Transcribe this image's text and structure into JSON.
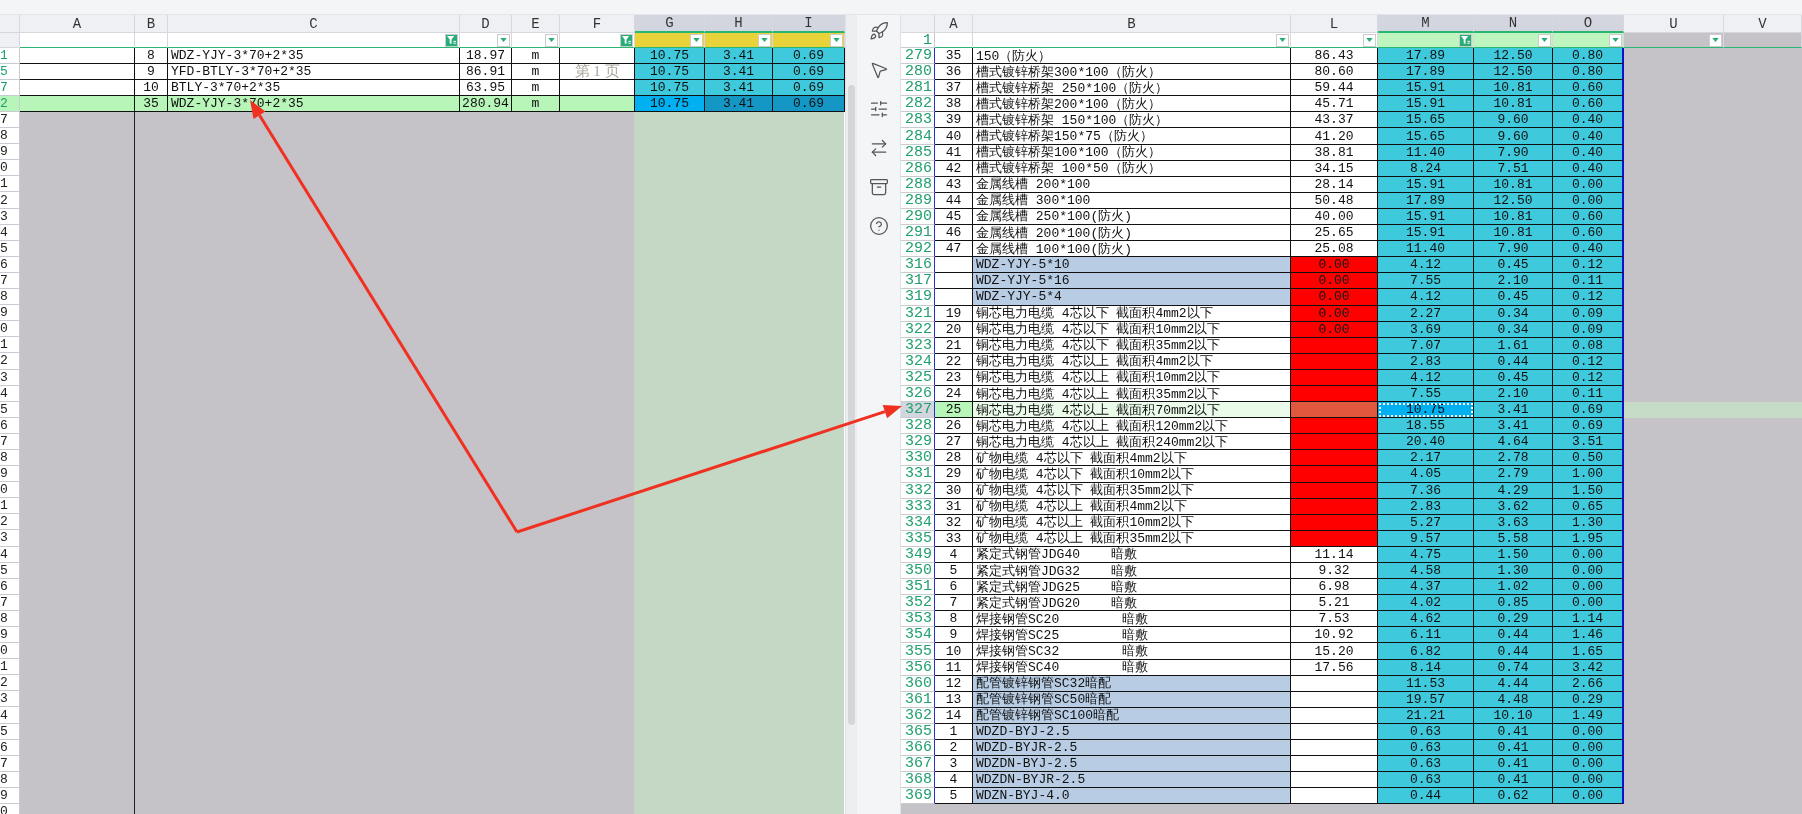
{
  "left_sheet": {
    "columns": [
      {
        "label": "A",
        "filter_button": false,
        "selected": false,
        "color": "#ffffff"
      },
      {
        "label": "B",
        "filter_button": false,
        "selected": false,
        "color": "#ffffff"
      },
      {
        "label": "C",
        "filter_button": true,
        "filter_applied": true,
        "selected": false,
        "color": "#ffffff"
      },
      {
        "label": "D",
        "filter_button": true,
        "filter_applied": false,
        "selected": false,
        "color": "#ffffff"
      },
      {
        "label": "E",
        "filter_button": true,
        "filter_applied": false,
        "selected": false,
        "color": "#ffffff"
      },
      {
        "label": "F",
        "filter_button": true,
        "filter_applied": true,
        "selected": false,
        "color": "#ffffff"
      },
      {
        "label": "G",
        "filter_button": true,
        "filter_applied": false,
        "selected": true,
        "color": "#e8d43a"
      },
      {
        "label": "H",
        "filter_button": true,
        "filter_applied": false,
        "selected": true,
        "color": "#e8d43a"
      },
      {
        "label": "I",
        "filter_button": true,
        "filter_applied": false,
        "selected": true,
        "color": "#e8d43a"
      }
    ],
    "rows": [
      {
        "header": "1",
        "selected": false,
        "cells": [
          "",
          "8",
          "WDZ-YJY-3*70+2*35",
          "18.97",
          "m",
          "",
          "10.75",
          "3.41",
          "0.69"
        ]
      },
      {
        "header": "5",
        "selected": false,
        "cells": [
          "",
          "9",
          "YFD-BTLY-3*70+2*35",
          "86.91",
          "m",
          "",
          "10.75",
          "3.41",
          "0.69"
        ]
      },
      {
        "header": "7",
        "selected": false,
        "cells": [
          "",
          "10",
          "BTLY-3*70+2*35",
          "63.95",
          "m",
          "",
          "10.75",
          "3.41",
          "0.69"
        ]
      },
      {
        "header": "2",
        "selected": true,
        "cells": [
          "",
          "35",
          "WDZ-YJY-3*70+2*35",
          "280.94",
          "m",
          "",
          "10.75",
          "3.41",
          "0.69"
        ]
      }
    ],
    "page_label": "第 1 页",
    "empty_row_headers": [
      "7",
      "8",
      "9",
      "0",
      "1",
      "2",
      "3",
      "4",
      "5",
      "6",
      "7",
      "8",
      "9",
      "0",
      "1",
      "2",
      "3",
      "4",
      "5",
      "6",
      "7",
      "8",
      "9",
      "0",
      "1",
      "2",
      "3",
      "4",
      "5",
      "6",
      "7",
      "8",
      "9",
      "0",
      "1",
      "2",
      "3",
      "4",
      "5",
      "6",
      "7",
      "8",
      "9",
      "0"
    ]
  },
  "right_sheet": {
    "filter_row_label": "1",
    "columns": [
      {
        "label": "A",
        "filter_button": false,
        "selected": false,
        "color": "#ffffff"
      },
      {
        "label": "B",
        "filter_button": true,
        "filter_applied": false,
        "selected": false,
        "color": "#ffffff"
      },
      {
        "label": "L",
        "filter_button": true,
        "filter_applied": false,
        "selected": false,
        "color": "#ffffff"
      },
      {
        "label": "M",
        "filter_button": true,
        "filter_applied": true,
        "selected": true,
        "color": "#bff5bf"
      },
      {
        "label": "N",
        "filter_button": true,
        "filter_applied": false,
        "selected": true,
        "color": "#bff5bf"
      },
      {
        "label": "O",
        "filter_button": true,
        "filter_applied": false,
        "selected": true,
        "color": "#bff5bf"
      },
      {
        "label": "U",
        "filter_button": true,
        "filter_applied": false,
        "selected": false,
        "color": "#c5c3c8"
      },
      {
        "label": "V",
        "filter_button": false,
        "selected": false,
        "color": "#c5c3c8"
      }
    ],
    "rows": [
      {
        "header": "279",
        "a": "35",
        "b": "150（防火）",
        "l": "86.43",
        "m": "17.89",
        "n": "12.50",
        "o": "0.80",
        "b_shaded": false,
        "l_alert": false,
        "selected": false
      },
      {
        "header": "280",
        "a": "36",
        "b": "槽式镀锌桥架300*100（防火）",
        "l": "80.60",
        "m": "17.89",
        "n": "12.50",
        "o": "0.80",
        "b_shaded": false,
        "l_alert": false,
        "selected": false
      },
      {
        "header": "281",
        "a": "37",
        "b": "槽式镀锌桥架 250*100（防火）",
        "l": "59.44",
        "m": "15.91",
        "n": "10.81",
        "o": "0.60",
        "b_shaded": false,
        "l_alert": false,
        "selected": false
      },
      {
        "header": "282",
        "a": "38",
        "b": "槽式镀锌桥架200*100（防火）",
        "l": "45.71",
        "m": "15.91",
        "n": "10.81",
        "o": "0.60",
        "b_shaded": false,
        "l_alert": false,
        "selected": false
      },
      {
        "header": "283",
        "a": "39",
        "b": "槽式镀锌桥架 150*100（防火）",
        "l": "43.37",
        "m": "15.65",
        "n": "9.60",
        "o": "0.40",
        "b_shaded": false,
        "l_alert": false,
        "selected": false
      },
      {
        "header": "284",
        "a": "40",
        "b": "槽式镀锌桥架150*75（防火）",
        "l": "41.20",
        "m": "15.65",
        "n": "9.60",
        "o": "0.40",
        "b_shaded": false,
        "l_alert": false,
        "selected": false
      },
      {
        "header": "285",
        "a": "41",
        "b": "槽式镀锌桥架100*100（防火）",
        "l": "38.81",
        "m": "11.40",
        "n": "7.90",
        "o": "0.40",
        "b_shaded": false,
        "l_alert": false,
        "selected": false
      },
      {
        "header": "286",
        "a": "42",
        "b": "槽式镀锌桥架 100*50（防火）",
        "l": "34.15",
        "m": "8.24",
        "n": "7.51",
        "o": "0.40",
        "b_shaded": false,
        "l_alert": false,
        "selected": false
      },
      {
        "header": "288",
        "a": "43",
        "b": "金属线槽 200*100",
        "l": "28.14",
        "m": "15.91",
        "n": "10.81",
        "o": "0.00",
        "b_shaded": false,
        "l_alert": false,
        "selected": false
      },
      {
        "header": "289",
        "a": "44",
        "b": "金属线槽 300*100",
        "l": "50.48",
        "m": "17.89",
        "n": "12.50",
        "o": "0.00",
        "b_shaded": false,
        "l_alert": false,
        "selected": false
      },
      {
        "header": "290",
        "a": "45",
        "b": "金属线槽 250*100(防火)",
        "l": "40.00",
        "m": "15.91",
        "n": "10.81",
        "o": "0.60",
        "b_shaded": false,
        "l_alert": false,
        "selected": false
      },
      {
        "header": "291",
        "a": "46",
        "b": "金属线槽 200*100(防火)",
        "l": "25.65",
        "m": "15.91",
        "n": "10.81",
        "o": "0.60",
        "b_shaded": false,
        "l_alert": false,
        "selected": false
      },
      {
        "header": "292",
        "a": "47",
        "b": "金属线槽 100*100(防火)",
        "l": "25.08",
        "m": "11.40",
        "n": "7.90",
        "o": "0.40",
        "b_shaded": false,
        "l_alert": false,
        "selected": false
      },
      {
        "header": "316",
        "a": "",
        "b": "WDZ-YJY-5*10",
        "l": "0.00",
        "m": "4.12",
        "n": "0.45",
        "o": "0.12",
        "b_shaded": true,
        "l_alert": true,
        "selected": false
      },
      {
        "header": "317",
        "a": "",
        "b": "WDZ-YJY-5*16",
        "l": "0.00",
        "m": "7.55",
        "n": "2.10",
        "o": "0.11",
        "b_shaded": true,
        "l_alert": true,
        "selected": false
      },
      {
        "header": "319",
        "a": "",
        "b": "WDZ-YJY-5*4",
        "l": "0.00",
        "m": "4.12",
        "n": "0.45",
        "o": "0.12",
        "b_shaded": true,
        "l_alert": true,
        "selected": false
      },
      {
        "header": "321",
        "a": "19",
        "b": "铜芯电力电缆 4芯以下 截面积4mm2以下",
        "l": "0.00",
        "m": "2.27",
        "n": "0.34",
        "o": "0.09",
        "b_shaded": false,
        "l_alert": true,
        "selected": false
      },
      {
        "header": "322",
        "a": "20",
        "b": "铜芯电力电缆 4芯以下 截面积10mm2以下",
        "l": "0.00",
        "m": "3.69",
        "n": "0.34",
        "o": "0.09",
        "b_shaded": false,
        "l_alert": true,
        "selected": false
      },
      {
        "header": "323",
        "a": "21",
        "b": "铜芯电力电缆 4芯以下 截面积35mm2以下",
        "l": "",
        "m": "7.07",
        "n": "1.61",
        "o": "0.08",
        "b_shaded": false,
        "l_alert": true,
        "selected": false
      },
      {
        "header": "324",
        "a": "22",
        "b": "铜芯电力电缆 4芯以上 截面积4mm2以下",
        "l": "",
        "m": "2.83",
        "n": "0.44",
        "o": "0.12",
        "b_shaded": false,
        "l_alert": true,
        "selected": false
      },
      {
        "header": "325",
        "a": "23",
        "b": "铜芯电力电缆 4芯以上 截面积10mm2以下",
        "l": "",
        "m": "4.12",
        "n": "0.45",
        "o": "0.12",
        "b_shaded": false,
        "l_alert": true,
        "selected": false
      },
      {
        "header": "326",
        "a": "24",
        "b": "铜芯电力电缆 4芯以上 截面积35mm2以下",
        "l": "",
        "m": "7.55",
        "n": "2.10",
        "o": "0.11",
        "b_shaded": false,
        "l_alert": true,
        "selected": false
      },
      {
        "header": "327",
        "a": "25",
        "b": "铜芯电力电缆 4芯以上 截面积70mm2以下",
        "l": "",
        "m": "10.75",
        "n": "3.41",
        "o": "0.69",
        "b_shaded": false,
        "l_alert": true,
        "selected": true
      },
      {
        "header": "328",
        "a": "26",
        "b": "铜芯电力电缆 4芯以上 截面积120mm2以下",
        "l": "",
        "m": "18.55",
        "n": "3.41",
        "o": "0.69",
        "b_shaded": false,
        "l_alert": true,
        "selected": false
      },
      {
        "header": "329",
        "a": "27",
        "b": "铜芯电力电缆 4芯以上 截面积240mm2以下",
        "l": "",
        "m": "20.40",
        "n": "4.64",
        "o": "3.51",
        "b_shaded": false,
        "l_alert": true,
        "selected": false
      },
      {
        "header": "330",
        "a": "28",
        "b": "矿物电缆 4芯以下 截面积4mm2以下",
        "l": "",
        "m": "2.17",
        "n": "2.78",
        "o": "0.50",
        "b_shaded": false,
        "l_alert": true,
        "selected": false
      },
      {
        "header": "331",
        "a": "29",
        "b": "矿物电缆 4芯以下 截面积10mm2以下",
        "l": "",
        "m": "4.05",
        "n": "2.79",
        "o": "1.00",
        "b_shaded": false,
        "l_alert": true,
        "selected": false
      },
      {
        "header": "332",
        "a": "30",
        "b": "矿物电缆 4芯以下 截面积35mm2以下",
        "l": "",
        "m": "7.36",
        "n": "4.29",
        "o": "1.50",
        "b_shaded": false,
        "l_alert": true,
        "selected": false
      },
      {
        "header": "333",
        "a": "31",
        "b": "矿物电缆 4芯以上 截面积4mm2以下",
        "l": "",
        "m": "2.83",
        "n": "3.62",
        "o": "0.65",
        "b_shaded": false,
        "l_alert": true,
        "selected": false
      },
      {
        "header": "334",
        "a": "32",
        "b": "矿物电缆 4芯以上 截面积10mm2以下",
        "l": "",
        "m": "5.27",
        "n": "3.63",
        "o": "1.30",
        "b_shaded": false,
        "l_alert": true,
        "selected": false
      },
      {
        "header": "335",
        "a": "33",
        "b": "矿物电缆 4芯以上 截面积35mm2以下",
        "l": "",
        "m": "9.57",
        "n": "5.58",
        "o": "1.95",
        "b_shaded": false,
        "l_alert": true,
        "selected": false
      },
      {
        "header": "349",
        "a": "4",
        "b": "紧定式钢管JDG40    暗敷",
        "l": "11.14",
        "m": "4.75",
        "n": "1.50",
        "o": "0.00",
        "b_shaded": false,
        "l_alert": false,
        "selected": false
      },
      {
        "header": "350",
        "a": "5",
        "b": "紧定式钢管JDG32    暗敷",
        "l": "9.32",
        "m": "4.58",
        "n": "1.30",
        "o": "0.00",
        "b_shaded": false,
        "l_alert": false,
        "selected": false
      },
      {
        "header": "351",
        "a": "6",
        "b": "紧定式钢管JDG25    暗敷",
        "l": "6.98",
        "m": "4.37",
        "n": "1.02",
        "o": "0.00",
        "b_shaded": false,
        "l_alert": false,
        "selected": false
      },
      {
        "header": "352",
        "a": "7",
        "b": "紧定式钢管JDG20    暗敷",
        "l": "5.21",
        "m": "4.02",
        "n": "0.85",
        "o": "0.00",
        "b_shaded": false,
        "l_alert": false,
        "selected": false
      },
      {
        "header": "353",
        "a": "8",
        "b": "焊接钢管SC20        暗敷",
        "l": "7.53",
        "m": "4.62",
        "n": "0.29",
        "o": "1.14",
        "b_shaded": false,
        "l_alert": false,
        "selected": false
      },
      {
        "header": "354",
        "a": "9",
        "b": "焊接钢管SC25        暗敷",
        "l": "10.92",
        "m": "6.11",
        "n": "0.44",
        "o": "1.46",
        "b_shaded": false,
        "l_alert": false,
        "selected": false
      },
      {
        "header": "355",
        "a": "10",
        "b": "焊接钢管SC32        暗敷",
        "l": "15.20",
        "m": "6.82",
        "n": "0.44",
        "o": "1.65",
        "b_shaded": false,
        "l_alert": false,
        "selected": false
      },
      {
        "header": "356",
        "a": "11",
        "b": "焊接钢管SC40        暗敷",
        "l": "17.56",
        "m": "8.14",
        "n": "0.74",
        "o": "3.42",
        "b_shaded": false,
        "l_alert": false,
        "selected": false
      },
      {
        "header": "360",
        "a": "12",
        "b": "配管镀锌钢管SC32暗配",
        "l": "",
        "m": "11.53",
        "n": "4.44",
        "o": "2.66",
        "b_shaded": true,
        "l_alert": false,
        "selected": false
      },
      {
        "header": "361",
        "a": "13",
        "b": "配管镀锌钢管SC50暗配",
        "l": "",
        "m": "19.57",
        "n": "4.48",
        "o": "0.29",
        "b_shaded": true,
        "l_alert": false,
        "selected": false
      },
      {
        "header": "362",
        "a": "14",
        "b": "配管镀锌钢管SC100暗配",
        "l": "",
        "m": "21.21",
        "n": "10.10",
        "o": "1.49",
        "b_shaded": true,
        "l_alert": false,
        "selected": false
      },
      {
        "header": "365",
        "a": "1",
        "b": "WDZD-BYJ-2.5",
        "l": "",
        "m": "0.63",
        "n": "0.41",
        "o": "0.00",
        "b_shaded": true,
        "l_alert": false,
        "selected": false
      },
      {
        "header": "366",
        "a": "2",
        "b": "WDZD-BYJR-2.5",
        "l": "",
        "m": "0.63",
        "n": "0.41",
        "o": "0.00",
        "b_shaded": true,
        "l_alert": false,
        "selected": false
      },
      {
        "header": "367",
        "a": "3",
        "b": "WDZDN-BYJ-2.5",
        "l": "",
        "m": "0.63",
        "n": "0.41",
        "o": "0.00",
        "b_shaded": true,
        "l_alert": false,
        "selected": false
      },
      {
        "header": "368",
        "a": "4",
        "b": "WDZDN-BYJR-2.5",
        "l": "",
        "m": "0.63",
        "n": "0.41",
        "o": "0.00",
        "b_shaded": true,
        "l_alert": false,
        "selected": false
      },
      {
        "header": "369",
        "a": "5",
        "b": "WDZN-BYJ-4.0",
        "l": "",
        "m": "0.44",
        "n": "0.62",
        "o": "0.00",
        "b_shaded": true,
        "l_alert": false,
        "selected": false
      }
    ]
  }
}
